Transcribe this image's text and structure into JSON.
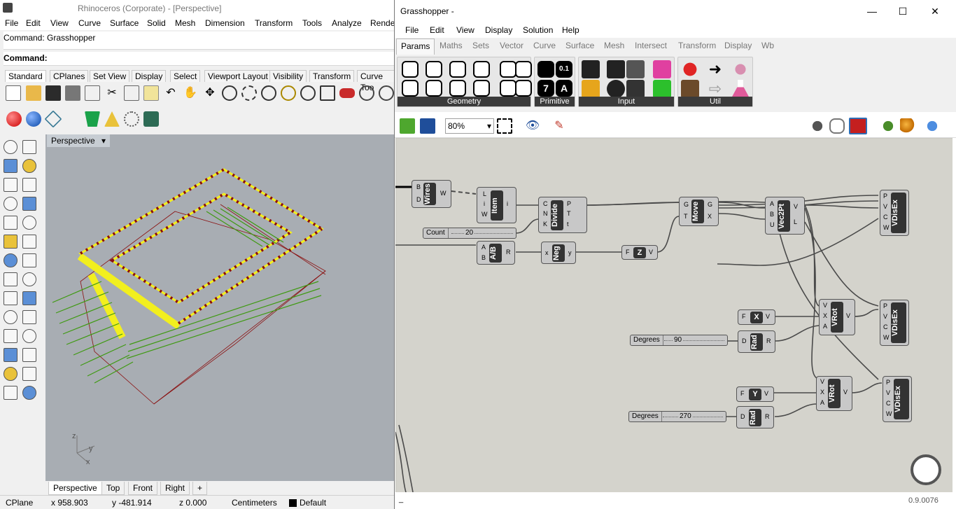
{
  "rhino": {
    "title": "Rhinoceros (Corporate) - [Perspective]",
    "menu": [
      "File",
      "Edit",
      "View",
      "Curve",
      "Surface",
      "Solid",
      "Mesh",
      "Dimension",
      "Transform",
      "Tools",
      "Analyze",
      "Rende"
    ],
    "command_history": "Command: Grasshopper",
    "command_prompt": "Command:",
    "toolbar_tabs": [
      "Standard",
      "CPlanes",
      "Set View",
      "Display",
      "Select",
      "Viewport Layout",
      "Visibility",
      "Transform",
      "Curve Too"
    ],
    "viewport_title": "Perspective",
    "viewport_tabs": [
      "Perspective",
      "Top",
      "Front",
      "Right",
      "+"
    ],
    "axis_labels": {
      "z": "z",
      "y": "y",
      "x": "x"
    },
    "status": {
      "cplane": "CPlane",
      "x": "x 958.903",
      "y": "y -481.914",
      "z": "z 0.000",
      "units": "Centimeters",
      "layer": "Default"
    }
  },
  "grasshopper": {
    "title": "Grasshopper -",
    "menu": [
      "File",
      "Edit",
      "View",
      "Display",
      "Solution",
      "Help"
    ],
    "tabs": [
      "Params",
      "Maths",
      "Sets",
      "Vector",
      "Curve",
      "Surface",
      "Mesh",
      "Intersect",
      "Transform",
      "Display",
      "Wb"
    ],
    "ribbon_groups": [
      "Geometry",
      "Primitive",
      "Input",
      "Util"
    ],
    "primitive_labels": {
      "num": "0.1",
      "int": "7",
      "text": "A"
    },
    "zoom": "80%",
    "version": "0.9.0076",
    "status_left": "_",
    "components": {
      "wires": {
        "name": "Wires",
        "inputs": [
          "B",
          "D"
        ],
        "outputs": [
          "W"
        ]
      },
      "item": {
        "name": "Item",
        "inputs": [
          "L",
          "i",
          "W"
        ],
        "outputs": [
          "i"
        ]
      },
      "divide": {
        "name": "Divide",
        "inputs": [
          "C",
          "N",
          "K"
        ],
        "outputs": [
          "P",
          "T",
          "t"
        ]
      },
      "move": {
        "name": "Move",
        "inputs": [
          "G",
          "T"
        ],
        "outputs": [
          "G",
          "X"
        ]
      },
      "vec2pt": {
        "name": "Vec2Pt",
        "inputs": [
          "A",
          "B",
          "U"
        ],
        "outputs": [
          "V",
          "L"
        ]
      },
      "visex1": {
        "name": "VDisEx",
        "inputs": [
          "P",
          "V",
          "C",
          "W"
        ]
      },
      "ab": {
        "name": "A/B",
        "inputs": [
          "A",
          "B"
        ],
        "outputs": [
          "R"
        ]
      },
      "neg": {
        "name": "Neg",
        "inputs": [
          "x"
        ],
        "outputs": [
          "y"
        ]
      },
      "z": {
        "name": "Z",
        "inputs": [
          "F"
        ],
        "outputs": [
          "V"
        ]
      },
      "x": {
        "name": "X",
        "inputs": [
          "F"
        ],
        "outputs": [
          "V"
        ]
      },
      "rad1": {
        "name": "Rad",
        "inputs": [
          "D"
        ],
        "outputs": [
          "R"
        ]
      },
      "vrot1": {
        "name": "VRot",
        "inputs": [
          "V",
          "X",
          "A"
        ],
        "outputs": [
          "V"
        ]
      },
      "visex2": {
        "name": "VDisEx",
        "inputs": [
          "P",
          "V",
          "C",
          "W"
        ]
      },
      "y": {
        "name": "Y",
        "inputs": [
          "F"
        ],
        "outputs": [
          "V"
        ]
      },
      "rad2": {
        "name": "Rad",
        "inputs": [
          "D"
        ],
        "outputs": [
          "R"
        ]
      },
      "vrot2": {
        "name": "VRot",
        "inputs": [
          "V",
          "X",
          "A"
        ],
        "outputs": [
          "V"
        ]
      },
      "visex3": {
        "name": "VDisEx",
        "inputs": [
          "P",
          "V",
          "C",
          "W"
        ]
      }
    },
    "sliders": {
      "count": {
        "label": "Count",
        "value": "20"
      },
      "deg90": {
        "label": "Degrees",
        "value": "90"
      },
      "deg270": {
        "label": "Degrees",
        "value": "270"
      }
    }
  },
  "colors": {
    "accent": "#2f6db5",
    "wire": "#4a4a4a",
    "canvas": "#d4d3cc",
    "viewport": "#a8adb3",
    "yellow": "#f2ef1e",
    "green": "#3f9a12",
    "red": "#8a1010"
  }
}
